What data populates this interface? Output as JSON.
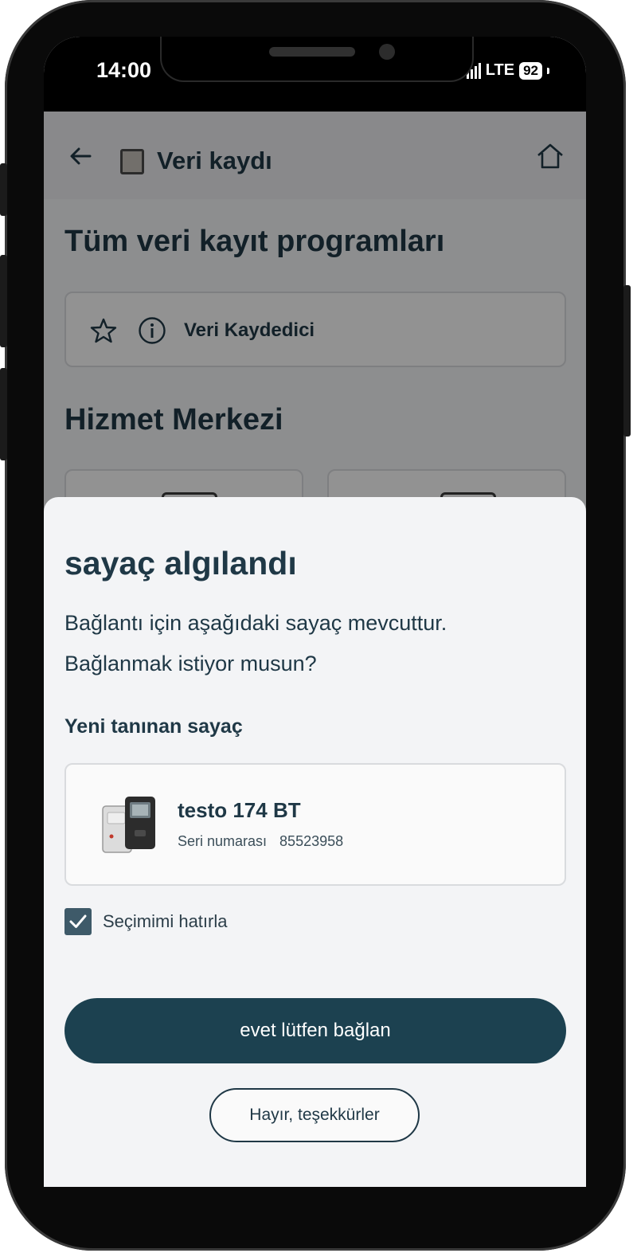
{
  "status_bar": {
    "time": "14:00",
    "network": "LTE",
    "battery": "92"
  },
  "app_bar": {
    "title": "Veri kaydı"
  },
  "programs": {
    "heading": "Tüm veri kayıt programları",
    "item_label": "Veri Kaydedici"
  },
  "service": {
    "heading": "Hizmet Merkezi"
  },
  "dialog": {
    "title": "sayaç algılandı",
    "message_line1": "Bağlantı için aşağıdaki sayaç mevcuttur.",
    "message_line2": "Bağlanmak istiyor musun?",
    "device_heading": "Yeni tanınan sayaç",
    "device": {
      "name": "testo 174 BT",
      "serial_label": "Seri numarası",
      "serial_value": "85523958"
    },
    "remember": {
      "label": "Seçimimi hatırla",
      "checked": true
    },
    "confirm_label": "evet lütfen bağlan",
    "decline_label": "Hayır, teşekkürler"
  },
  "colors": {
    "primary": "#1c4150",
    "text": "#1f3846",
    "checkbox": "#3e5a69"
  }
}
